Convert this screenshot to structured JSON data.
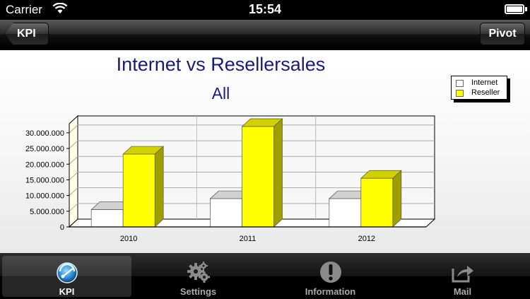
{
  "status_bar": {
    "carrier": "Carrier",
    "time": "15:54"
  },
  "nav": {
    "back_label": "KPI",
    "pivot_label": "Pivot"
  },
  "chart_data": {
    "type": "bar",
    "title": "Internet vs Resellersales",
    "subtitle": "All",
    "categories": [
      "2010",
      "2011",
      "2012"
    ],
    "series": [
      {
        "name": "Internet",
        "values": [
          5500000,
          9000000,
          9000000
        ],
        "color": "#ffffff"
      },
      {
        "name": "Reseller",
        "values": [
          23200000,
          32000000,
          15500000
        ],
        "color": "#ffff00"
      }
    ],
    "y_ticks": [
      "0",
      "5.000.000",
      "10.000.000",
      "15.000.000",
      "20.000.000",
      "25.000.000",
      "30.000.000"
    ],
    "ylim": [
      0,
      32000000
    ],
    "grid": true,
    "legend_position": "top-right",
    "style": "3d"
  },
  "tabbar": {
    "tabs": [
      {
        "label": "KPI",
        "icon": "speedometer-icon",
        "active": true
      },
      {
        "label": "Settings",
        "icon": "gears-icon",
        "active": false
      },
      {
        "label": "Information",
        "icon": "exclamation-icon",
        "active": false
      },
      {
        "label": "Mail",
        "icon": "share-arrow-icon",
        "active": false
      }
    ]
  }
}
